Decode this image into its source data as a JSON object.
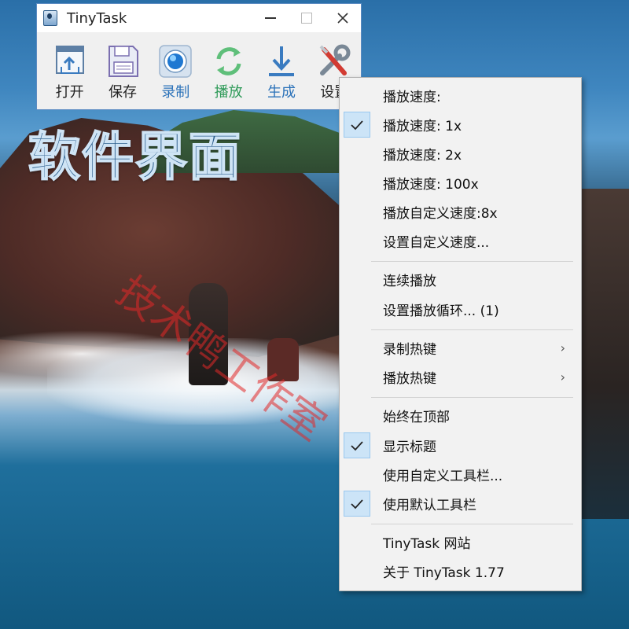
{
  "window": {
    "title": "TinyTask",
    "controls": {
      "minimize": "—",
      "maximize": "☐",
      "close": "✕"
    }
  },
  "toolbar": {
    "items": [
      {
        "label": "打开",
        "icon": "open-icon"
      },
      {
        "label": "保存",
        "icon": "save-icon"
      },
      {
        "label": "录制",
        "icon": "record-icon"
      },
      {
        "label": "播放",
        "icon": "play-icon"
      },
      {
        "label": "生成",
        "icon": "compile-icon"
      },
      {
        "label": "设置",
        "icon": "settings-icon"
      }
    ]
  },
  "overlay": {
    "headline": "软件界面",
    "watermark": "技术鸭工作室"
  },
  "menu": {
    "items": [
      {
        "label": "播放速度:",
        "checked": false
      },
      {
        "label": "播放速度:   1x",
        "checked": true
      },
      {
        "label": "播放速度:   2x",
        "checked": false
      },
      {
        "label": "播放速度:   100x",
        "checked": false
      },
      {
        "label": "播放自定义速度:8x",
        "checked": false
      },
      {
        "label": "设置自定义速度...",
        "checked": false
      },
      {
        "label": "连续播放",
        "checked": false
      },
      {
        "label": "设置播放循环...  (1)",
        "checked": false
      },
      {
        "label": "录制热键",
        "checked": false,
        "submenu": "›"
      },
      {
        "label": "播放热键",
        "checked": false,
        "submenu": "›"
      },
      {
        "label": "始终在顶部",
        "checked": false
      },
      {
        "label": "显示标题",
        "checked": true
      },
      {
        "label": "使用自定义工具栏...",
        "checked": false
      },
      {
        "label": "使用默认工具栏",
        "checked": true
      },
      {
        "label": "TinyTask 网站",
        "checked": false
      },
      {
        "label": "关于 TinyTask 1.77",
        "checked": false
      }
    ]
  },
  "colors": {
    "accent_blue": "#2b72b9",
    "check_highlight": "#cce4f7",
    "window_border": "#5b8bc2"
  }
}
